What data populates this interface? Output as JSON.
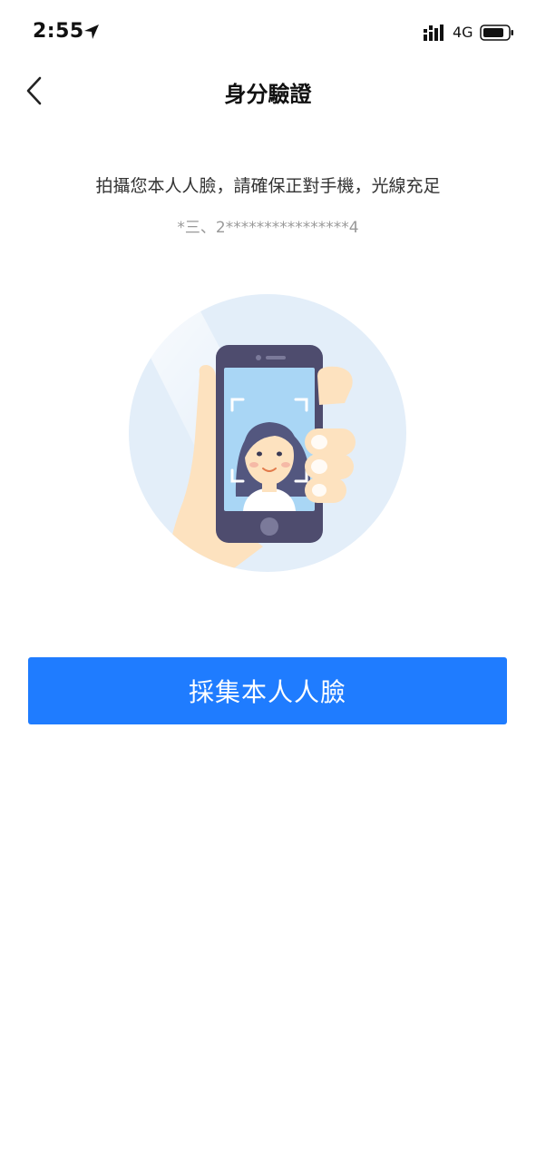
{
  "status_bar": {
    "time": "2:55",
    "network": "4G"
  },
  "header": {
    "title": "身分驗證"
  },
  "main": {
    "instruction": "拍攝您本人人臉，請確保正對手機，光線充足",
    "masked_id": "*三、2****************4",
    "action_button_label": "採集本人人臉"
  },
  "icons": {
    "back": "chevron-left-icon",
    "location": "location-arrow-icon",
    "signal": "cellular-signal-icon",
    "battery": "battery-icon"
  },
  "colors": {
    "primary": "#1f7cff",
    "circle_bg": "#e3eef9",
    "phone_body": "#4e4c6e",
    "screen": "#a9d6f5",
    "skin": "#fde2bf",
    "hair": "#53577f"
  }
}
